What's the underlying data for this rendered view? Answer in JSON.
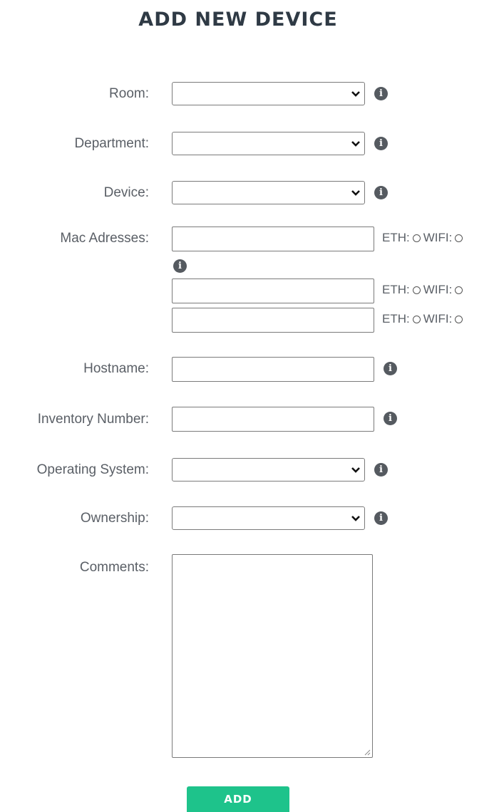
{
  "page": {
    "title": "ADD NEW DEVICE"
  },
  "form": {
    "room": {
      "label": "Room:",
      "value": ""
    },
    "department": {
      "label": "Department:",
      "value": ""
    },
    "device": {
      "label": "Device:",
      "value": ""
    },
    "mac": {
      "label": "Mac Adresses:",
      "rows": [
        {
          "value": "",
          "eth_label": "ETH:",
          "wifi_label": "WIFI:"
        },
        {
          "value": "",
          "eth_label": "ETH:",
          "wifi_label": "WIFI:"
        },
        {
          "value": "",
          "eth_label": "ETH:",
          "wifi_label": "WIFI:"
        }
      ]
    },
    "hostname": {
      "label": "Hostname:",
      "value": ""
    },
    "inventory": {
      "label": "Inventory Number:",
      "value": ""
    },
    "os": {
      "label": "Operating System:",
      "value": ""
    },
    "ownership": {
      "label": "Ownership:",
      "value": ""
    },
    "comments": {
      "label": "Comments:",
      "value": ""
    },
    "submit_label": "ADD"
  },
  "icons": {
    "info": "info-icon",
    "dropdown": "chevron-down-icon",
    "resize": "resize-grip-icon"
  },
  "colors": {
    "accent": "#1ec38b",
    "title": "#2f3a45",
    "label": "#5a5f66",
    "info_icon": "#555a60"
  }
}
